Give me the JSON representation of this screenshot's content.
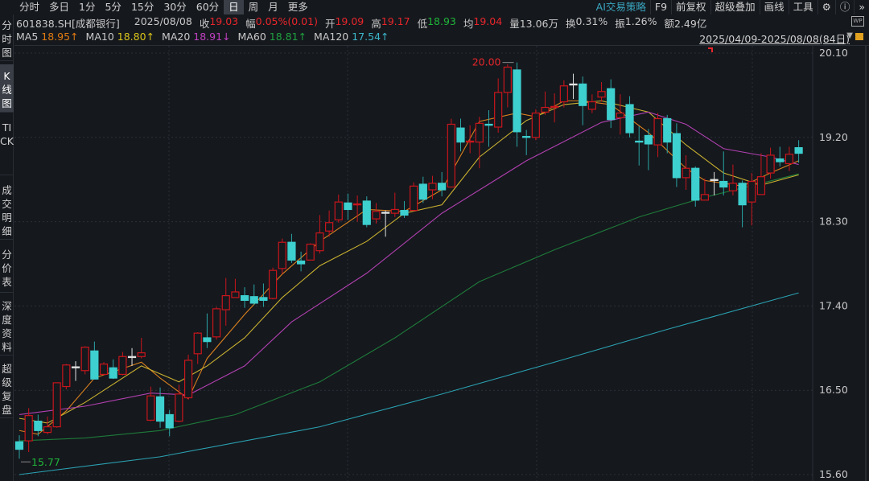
{
  "tabs": [
    "分时",
    "多日",
    "1分",
    "5分",
    "15分",
    "30分",
    "60分",
    "日",
    "周",
    "月",
    "更多"
  ],
  "selected_tab": "日",
  "right_tools": {
    "ai": "AI交易策略",
    "f9": "F9",
    "adjust": "前复权",
    "overlay": "超级叠加",
    "draw": "画线",
    "tools": "工具",
    "more": "»"
  },
  "sidebar": [
    {
      "label": "分时图"
    },
    {
      "label": "K线图"
    },
    {
      "label": "TICK"
    },
    {
      "label": "成交明细"
    },
    {
      "label": "分价表"
    },
    {
      "label": "深度资料"
    },
    {
      "label": "超级复盘"
    }
  ],
  "info": {
    "code": "601838.SH[成都银行]",
    "date": "2025/08/08",
    "close_label": "收",
    "close": "19.03",
    "change_label": "幅",
    "change": "0.05%(0.01)",
    "open_label": "开",
    "open": "19.09",
    "high_label": "高",
    "high": "19.17",
    "low_label": "低",
    "low": "18.93",
    "avg_label": "均",
    "avg": "19.04",
    "vol_label": "量",
    "vol": "13.06万",
    "turnover_label": "换",
    "turnover": "0.31%",
    "amp_label": "振",
    "amp": "1.26%",
    "amount_label": "额",
    "amount": "2.49亿"
  },
  "ma_legend": [
    {
      "name": "MA5",
      "value": "18.95↑",
      "color": "#e07b12"
    },
    {
      "name": "MA10",
      "value": "18.80↑",
      "color": "#d8c31a"
    },
    {
      "name": "MA20",
      "value": "18.91↓",
      "color": "#c040c0"
    },
    {
      "name": "MA60",
      "value": "18.81↑",
      "color": "#1fa040"
    },
    {
      "name": "MA120",
      "value": "17.54↑",
      "color": "#3cb6c8"
    }
  ],
  "range": "2025/04/09-2025/08/08(84日)",
  "wp_icon": "WP",
  "chart_data": {
    "type": "candlestick",
    "ylim": [
      15.6,
      20.1
    ],
    "ytick_labels": [
      "20.10",
      "19.20",
      "18.30",
      "17.40",
      "16.50",
      "15.60"
    ],
    "grid": true,
    "up_color": "#c8161d",
    "down_color": "#3ecfcf",
    "max_label": "20.00",
    "min_label": "15.77",
    "fields": [
      "open",
      "high",
      "low",
      "close"
    ],
    "candles": [
      [
        15.95,
        16.02,
        15.77,
        15.87
      ],
      [
        15.96,
        16.31,
        15.84,
        16.23
      ],
      [
        16.17,
        16.24,
        16.01,
        16.07
      ],
      [
        16.05,
        16.22,
        16.03,
        16.11
      ],
      [
        16.11,
        16.58,
        16.1,
        16.58
      ],
      [
        16.54,
        16.78,
        16.51,
        16.77
      ],
      [
        16.75,
        16.81,
        16.6,
        16.75
      ],
      [
        16.71,
        16.97,
        16.67,
        16.96
      ],
      [
        16.92,
        17.02,
        16.62,
        16.62
      ],
      [
        16.67,
        16.8,
        16.66,
        16.78
      ],
      [
        16.74,
        16.83,
        16.62,
        16.63
      ],
      [
        16.67,
        16.91,
        16.66,
        16.86
      ],
      [
        16.86,
        16.95,
        16.76,
        16.86
      ],
      [
        16.86,
        17.06,
        16.84,
        16.9
      ],
      [
        16.18,
        16.54,
        16.17,
        16.44
      ],
      [
        16.43,
        16.53,
        16.1,
        16.17
      ],
      [
        16.24,
        16.29,
        16.01,
        16.1
      ],
      [
        16.17,
        16.56,
        16.16,
        16.46
      ],
      [
        16.42,
        16.88,
        16.4,
        16.82
      ],
      [
        16.89,
        17.12,
        16.78,
        17.11
      ],
      [
        17.06,
        17.32,
        16.95,
        17.02
      ],
      [
        17.07,
        17.39,
        17.04,
        17.37
      ],
      [
        17.36,
        17.7,
        17.19,
        17.51
      ],
      [
        17.49,
        17.69,
        17.49,
        17.55
      ],
      [
        17.51,
        17.6,
        17.38,
        17.46
      ],
      [
        17.5,
        17.63,
        17.41,
        17.43
      ],
      [
        17.49,
        17.64,
        17.39,
        17.46
      ],
      [
        17.48,
        17.81,
        17.47,
        17.78
      ],
      [
        17.8,
        18.12,
        17.74,
        18.08
      ],
      [
        18.08,
        18.17,
        17.86,
        17.89
      ],
      [
        17.88,
        17.98,
        17.77,
        17.85
      ],
      [
        17.89,
        18.07,
        17.89,
        18.06
      ],
      [
        17.99,
        18.37,
        17.96,
        18.18
      ],
      [
        18.2,
        18.42,
        18.14,
        18.29
      ],
      [
        18.32,
        18.59,
        18.29,
        18.51
      ],
      [
        18.5,
        18.6,
        18.32,
        18.43
      ],
      [
        18.48,
        18.58,
        18.3,
        18.49
      ],
      [
        18.52,
        18.57,
        18.24,
        18.27
      ],
      [
        18.33,
        18.5,
        18.28,
        18.41
      ],
      [
        18.4,
        18.42,
        18.14,
        18.4
      ],
      [
        18.39,
        18.61,
        18.35,
        18.43
      ],
      [
        18.42,
        18.52,
        18.34,
        18.37
      ],
      [
        18.42,
        18.72,
        18.41,
        18.68
      ],
      [
        18.7,
        18.78,
        18.5,
        18.54
      ],
      [
        18.64,
        18.79,
        18.54,
        18.71
      ],
      [
        18.71,
        18.83,
        18.57,
        18.64
      ],
      [
        18.67,
        19.4,
        18.67,
        19.34
      ],
      [
        19.3,
        19.4,
        19.05,
        19.15
      ],
      [
        19.15,
        19.33,
        19.03,
        19.16
      ],
      [
        19.15,
        19.42,
        18.87,
        19.35
      ],
      [
        19.34,
        19.49,
        19.1,
        19.33
      ],
      [
        19.31,
        19.83,
        19.25,
        19.68
      ],
      [
        19.68,
        19.98,
        19.52,
        19.95
      ],
      [
        19.92,
        20.0,
        19.1,
        19.26
      ],
      [
        19.21,
        19.28,
        19.01,
        19.2
      ],
      [
        19.2,
        19.5,
        19.17,
        19.46
      ],
      [
        19.47,
        19.69,
        19.44,
        19.52
      ],
      [
        19.52,
        19.67,
        19.36,
        19.53
      ],
      [
        19.58,
        19.81,
        19.52,
        19.75
      ],
      [
        19.77,
        19.88,
        19.61,
        19.77
      ],
      [
        19.77,
        19.85,
        19.33,
        19.54
      ],
      [
        19.5,
        19.66,
        19.46,
        19.58
      ],
      [
        19.63,
        19.79,
        19.58,
        19.69
      ],
      [
        19.72,
        19.82,
        19.3,
        19.39
      ],
      [
        19.41,
        19.66,
        19.23,
        19.46
      ],
      [
        19.55,
        19.64,
        19.2,
        19.25
      ],
      [
        19.16,
        19.32,
        18.9,
        19.15
      ],
      [
        19.22,
        19.29,
        18.85,
        19.13
      ],
      [
        19.12,
        19.46,
        18.99,
        19.4
      ],
      [
        19.4,
        19.44,
        19.03,
        19.15
      ],
      [
        19.24,
        19.35,
        18.67,
        18.77
      ],
      [
        18.77,
        19.01,
        18.64,
        18.87
      ],
      [
        18.87,
        18.89,
        18.46,
        18.53
      ],
      [
        18.53,
        18.76,
        18.53,
        18.59
      ],
      [
        18.75,
        18.83,
        18.58,
        18.75
      ],
      [
        18.73,
        19.05,
        18.58,
        18.67
      ],
      [
        18.63,
        18.91,
        18.58,
        18.71
      ],
      [
        18.71,
        18.74,
        18.24,
        18.48
      ],
      [
        18.51,
        18.82,
        18.26,
        18.73
      ],
      [
        18.59,
        19.03,
        18.59,
        18.78
      ],
      [
        18.82,
        19.09,
        18.76,
        19.01
      ],
      [
        18.97,
        19.1,
        18.89,
        18.94
      ],
      [
        18.92,
        19.1,
        18.84,
        19.02
      ],
      [
        19.09,
        19.17,
        18.93,
        19.03
      ]
    ],
    "ma_series": [
      {
        "name": "MA5",
        "color": "#d9801e",
        "points": [
          [
            1,
            16.07
          ],
          [
            3,
            16.03
          ],
          [
            6,
            16.28
          ],
          [
            9,
            16.63
          ],
          [
            14,
            16.8
          ],
          [
            16,
            16.63
          ],
          [
            19,
            16.41
          ],
          [
            21,
            16.84
          ],
          [
            25,
            17.31
          ],
          [
            29,
            17.74
          ],
          [
            33,
            18.09
          ],
          [
            38,
            18.43
          ],
          [
            42,
            18.41
          ],
          [
            46,
            18.64
          ],
          [
            50,
            19.37
          ],
          [
            54,
            19.46
          ],
          [
            56,
            19.42
          ],
          [
            59,
            19.59
          ],
          [
            61,
            19.59
          ],
          [
            64,
            19.55
          ],
          [
            68,
            19.25
          ],
          [
            72,
            18.87
          ],
          [
            74,
            18.74
          ],
          [
            78,
            18.68
          ],
          [
            81,
            18.82
          ],
          [
            84,
            18.95
          ]
        ]
      },
      {
        "name": "MA10",
        "color": "#c8b030",
        "points": [
          [
            1,
            16.2
          ],
          [
            4,
            16.15
          ],
          [
            8,
            16.37
          ],
          [
            14,
            16.76
          ],
          [
            18,
            16.59
          ],
          [
            21,
            16.76
          ],
          [
            25,
            17.06
          ],
          [
            29,
            17.49
          ],
          [
            33,
            17.83
          ],
          [
            38,
            18.09
          ],
          [
            42,
            18.39
          ],
          [
            46,
            18.48
          ],
          [
            50,
            18.99
          ],
          [
            55,
            19.38
          ],
          [
            59,
            19.55
          ],
          [
            63,
            19.59
          ],
          [
            68,
            19.47
          ],
          [
            72,
            19.12
          ],
          [
            76,
            18.82
          ],
          [
            80,
            18.69
          ],
          [
            84,
            18.8
          ]
        ]
      },
      {
        "name": "MA20",
        "color": "#b040b0",
        "points": [
          [
            1,
            16.24
          ],
          [
            8,
            16.33
          ],
          [
            15,
            16.47
          ],
          [
            19,
            16.45
          ],
          [
            25,
            16.76
          ],
          [
            30,
            17.23
          ],
          [
            38,
            17.75
          ],
          [
            46,
            18.39
          ],
          [
            55,
            18.95
          ],
          [
            63,
            19.36
          ],
          [
            68,
            19.47
          ],
          [
            72,
            19.34
          ],
          [
            76,
            19.08
          ],
          [
            81,
            18.99
          ],
          [
            84,
            18.91
          ]
        ]
      },
      {
        "name": "MA60",
        "color": "#1e7a3a",
        "points": [
          [
            1,
            15.96
          ],
          [
            8,
            15.99
          ],
          [
            16,
            16.07
          ],
          [
            24,
            16.24
          ],
          [
            33,
            16.59
          ],
          [
            41,
            17.06
          ],
          [
            50,
            17.66
          ],
          [
            58,
            18.0
          ],
          [
            67,
            18.35
          ],
          [
            74,
            18.56
          ],
          [
            84,
            18.81
          ]
        ]
      },
      {
        "name": "MA120",
        "color": "#2aa0b0",
        "points": [
          [
            1,
            15.6
          ],
          [
            16,
            15.79
          ],
          [
            33,
            16.11
          ],
          [
            46,
            16.46
          ],
          [
            58,
            16.8
          ],
          [
            70,
            17.15
          ],
          [
            84,
            17.54
          ]
        ]
      }
    ]
  }
}
